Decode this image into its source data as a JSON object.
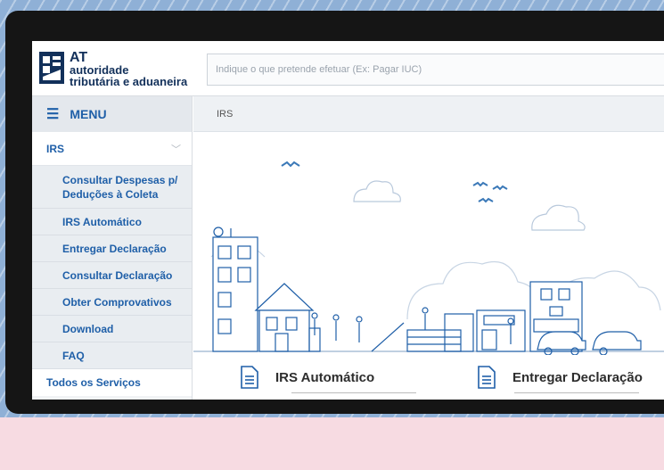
{
  "header": {
    "logo_at": "AT",
    "logo_line1": "autoridade",
    "logo_line2": "tributária e aduaneira",
    "search_placeholder": "Indique o que pretende efetuar (Ex: Pagar IUC)"
  },
  "sidebar": {
    "menu_label": "MENU",
    "section_label": "IRS",
    "items": [
      {
        "label": "Consultar Despesas p/ Deduções à Coleta"
      },
      {
        "label": "IRS Automático"
      },
      {
        "label": "Entregar Declaração"
      },
      {
        "label": "Consultar Declaração"
      },
      {
        "label": "Obter Comprovativos"
      },
      {
        "label": "Download"
      },
      {
        "label": "FAQ"
      }
    ],
    "all_services": "Todos os Serviços"
  },
  "breadcrumb": "IRS",
  "cards": [
    {
      "title": "IRS Automático"
    },
    {
      "title": "Entregar Declaração"
    }
  ],
  "colors": {
    "brand_blue": "#1f5fa8",
    "logo_navy": "#12305a",
    "background_pink": "#f7dbe2"
  }
}
